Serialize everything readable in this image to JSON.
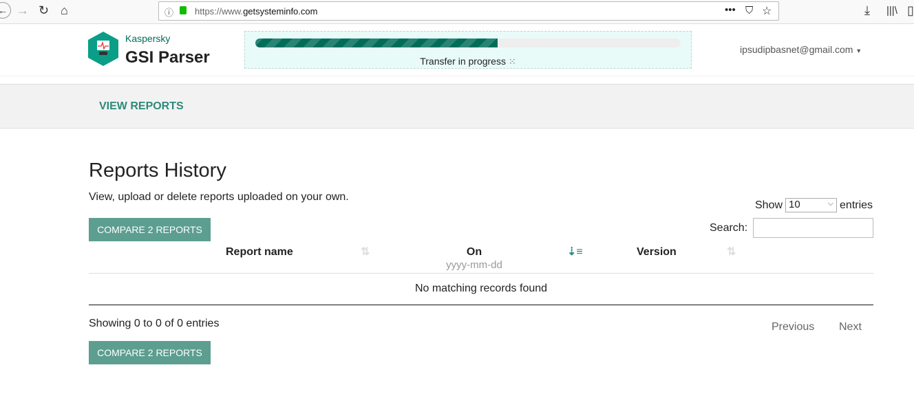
{
  "browser": {
    "url_prefix": "https://www.",
    "url_domain": "getsysteminfo.com"
  },
  "header": {
    "brand_small": "Kaspersky",
    "brand_title": "GSI Parser",
    "progress_percent": 57,
    "progress_text": "Transfer in progress",
    "user_email": "ipsudipbasnet@gmail.com"
  },
  "nav": {
    "view_reports": "VIEW REPORTS"
  },
  "main": {
    "title": "Reports History",
    "subtitle": "View, upload or delete reports uploaded on your own.",
    "show_label": "Show",
    "entries_value": "10",
    "entries_label": "entries",
    "search_label": "Search:",
    "search_value": "",
    "compare_button": "COMPARE 2 REPORTS",
    "columns": [
      {
        "label": "Report name"
      },
      {
        "label": "On",
        "sublabel": "yyyy-mm-dd"
      },
      {
        "label": "Version"
      }
    ],
    "empty_message": "No matching records found",
    "info": "Showing 0 to 0 of 0 entries",
    "previous": "Previous",
    "next": "Next"
  }
}
